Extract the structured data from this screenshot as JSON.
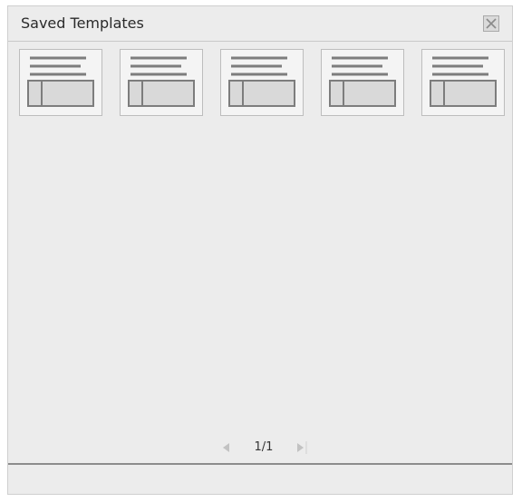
{
  "panel": {
    "title": "Saved Templates",
    "close_icon": "close-icon"
  },
  "templates": [
    {
      "icon": "template-thumbnail-icon"
    },
    {
      "icon": "template-thumbnail-icon"
    },
    {
      "icon": "template-thumbnail-icon"
    },
    {
      "icon": "template-thumbnail-icon"
    },
    {
      "icon": "template-thumbnail-icon"
    }
  ],
  "pager": {
    "label": "1/1",
    "prev_icon": "previous-page-icon",
    "next_icon": "next-page-icon"
  },
  "colors": {
    "panel_bg": "#ececec",
    "border": "#c9c9c9",
    "thumbnail_stroke": "#7d7d7d",
    "thumbnail_fill": "#d9d9d9"
  }
}
